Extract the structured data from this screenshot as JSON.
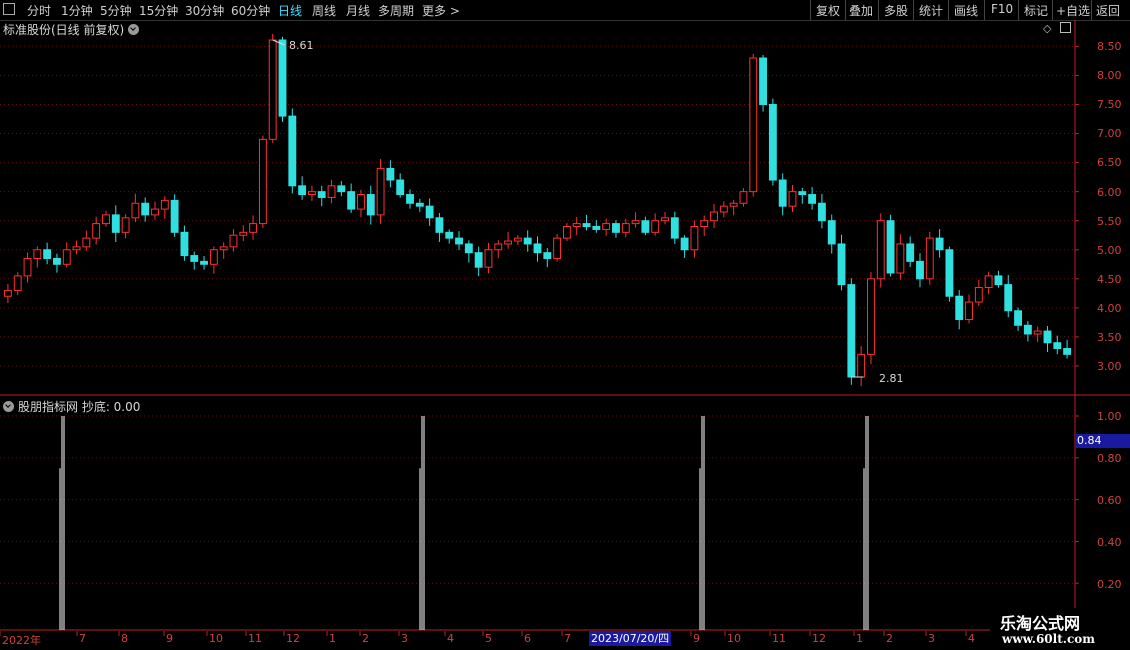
{
  "toolbar": {
    "left_items": [
      "分时",
      "1分钟",
      "5分钟",
      "15分钟",
      "30分钟",
      "60分钟",
      "日线",
      "周线",
      "月线",
      "多周期",
      "更多 >"
    ],
    "active": "日线",
    "right_items": [
      "复权",
      "叠加",
      "多股",
      "统计",
      "画线",
      "F10",
      "标记",
      "+自选",
      "返回"
    ]
  },
  "main_title": "标准股份(日线 前复权)",
  "indicator_title": "股朋指标网  抄底: 0.00",
  "price_axis": [
    "8.50",
    "8.00",
    "7.50",
    "7.00",
    "6.50",
    "6.00",
    "5.50",
    "5.00",
    "4.50",
    "4.00",
    "3.50",
    "3.00"
  ],
  "indicator_axis": [
    "1.00",
    "0.80",
    "0.60",
    "0.40",
    "0.20"
  ],
  "cursor_value": "0.84",
  "cursor_date": "2023/07/20/四",
  "max_label": "8.61",
  "min_label": "2.81",
  "dates": [
    "2022年",
    "7",
    "8",
    "9",
    "10",
    "11",
    "12",
    "1",
    "2",
    "3",
    "4",
    "5",
    "6",
    "7",
    "8",
    "9",
    "10",
    "11",
    "12",
    "1",
    "2",
    "3",
    "4",
    "5"
  ],
  "watermark": {
    "line1": "乐淘公式网",
    "line2": "www.60lt.com"
  },
  "colors": {
    "up": "#ff3030",
    "down": "#30e0e0",
    "axis": "#c02020",
    "grid": "#6a1010",
    "active_tab": "#3fe0ff"
  },
  "icons": [
    "window-icon",
    "chevron-down-icon",
    "diamond-icon",
    "panel-toggle-icon"
  ],
  "chart_data": {
    "type": "candlestick",
    "price_range": [
      2.81,
      8.61
    ],
    "close_series": [
      4.3,
      4.55,
      4.85,
      5.0,
      4.85,
      4.75,
      5.0,
      5.05,
      5.2,
      5.45,
      5.6,
      5.3,
      5.55,
      5.8,
      5.6,
      5.7,
      5.85,
      5.3,
      4.9,
      4.8,
      4.75,
      5.0,
      5.05,
      5.25,
      5.3,
      5.45,
      6.9,
      8.61,
      7.3,
      6.1,
      5.95,
      6.0,
      5.9,
      6.1,
      6.0,
      5.7,
      5.95,
      5.6,
      6.4,
      6.2,
      5.95,
      5.8,
      5.75,
      5.55,
      5.3,
      5.2,
      5.1,
      4.95,
      4.7,
      5.0,
      5.1,
      5.15,
      5.2,
      5.1,
      4.95,
      4.85,
      5.2,
      5.4,
      5.45,
      5.4,
      5.35,
      5.45,
      5.3,
      5.45,
      5.5,
      5.3,
      5.5,
      5.55,
      5.2,
      5.0,
      5.4,
      5.5,
      5.65,
      5.75,
      5.8,
      6.0,
      8.3,
      7.5,
      6.2,
      5.75,
      6.0,
      5.95,
      5.8,
      5.5,
      5.1,
      4.4,
      2.81,
      3.2,
      4.5,
      5.5,
      4.6,
      5.1,
      4.8,
      4.5,
      5.2,
      5.0,
      4.2,
      3.8,
      4.1,
      4.35,
      4.55,
      4.4,
      3.95,
      3.7,
      3.55,
      3.6,
      3.4,
      3.3,
      3.2
    ],
    "signals": [
      {
        "date_index": 1,
        "value": 1.0
      },
      {
        "date_index": 9,
        "value": 1.0
      },
      {
        "date_index": 15,
        "value": 1.0
      },
      {
        "date_index": 19,
        "value": 1.0
      }
    ],
    "indicator_range": [
      0,
      1.0
    ],
    "indicator_name": "抄底"
  }
}
